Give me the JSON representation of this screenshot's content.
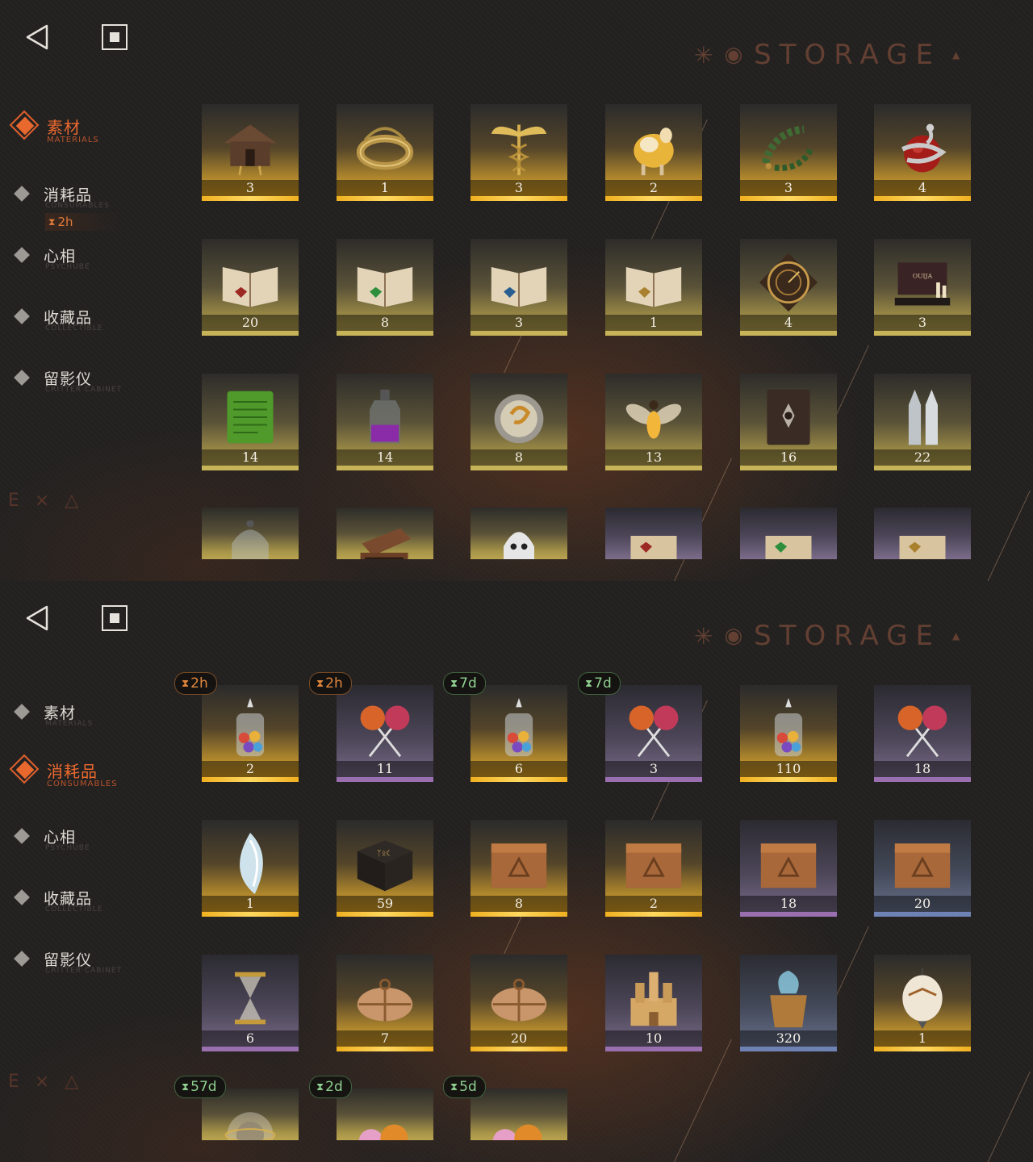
{
  "colors": {
    "accent": "#e8682e",
    "gold": "#e0a11e",
    "purple": "#9a6fb0",
    "blue": "#6f82b4",
    "khaki": "#c8b458",
    "timer_green": "#8fcf8f",
    "timer_orange": "#e0863c"
  },
  "header": {
    "title": "STORAGE",
    "back_icon": "back-triangle-icon",
    "stop_icon": "square-stop-icon"
  },
  "sidebar_deco": "E × △",
  "panels": [
    {
      "sidebar": [
        {
          "cn": "素材",
          "en": "MATERIALS",
          "active": true
        },
        {
          "cn": "消耗品",
          "en": "CONSUMABLES",
          "active": false,
          "timer": "2h"
        },
        {
          "cn": "心相",
          "en": "PSYCHUBE",
          "active": false
        },
        {
          "cn": "收藏品",
          "en": "COLLECTIBLE",
          "active": false
        },
        {
          "cn": "留影仪",
          "en": "CRITTER CABINET",
          "active": false
        }
      ],
      "rows": [
        [
          {
            "icon": "hut-icon",
            "qty": "3",
            "rarity": "gold"
          },
          {
            "icon": "ring-icon",
            "qty": "1",
            "rarity": "gold"
          },
          {
            "icon": "caduceus-icon",
            "qty": "3",
            "rarity": "gold"
          },
          {
            "icon": "golden-sheep-icon",
            "qty": "2",
            "rarity": "gold"
          },
          {
            "icon": "laurel-wreath-icon",
            "qty": "3",
            "rarity": "gold"
          },
          {
            "icon": "apple-serpent-icon",
            "qty": "4",
            "rarity": "gold"
          }
        ],
        [
          {
            "icon": "red-spellbook-icon",
            "qty": "20",
            "rarity": "khaki"
          },
          {
            "icon": "green-spellbook-icon",
            "qty": "8",
            "rarity": "khaki"
          },
          {
            "icon": "blue-spellbook-icon",
            "qty": "3",
            "rarity": "khaki"
          },
          {
            "icon": "gold-spellbook-icon",
            "qty": "1",
            "rarity": "khaki"
          },
          {
            "icon": "astrolabe-icon",
            "qty": "4",
            "rarity": "khaki"
          },
          {
            "icon": "ouija-board-icon",
            "qty": "3",
            "rarity": "khaki"
          }
        ],
        [
          {
            "icon": "green-tablet-icon",
            "qty": "14",
            "rarity": "khaki"
          },
          {
            "icon": "potion-bottle-icon",
            "qty": "14",
            "rarity": "khaki"
          },
          {
            "icon": "pocket-watch-icon",
            "qty": "8",
            "rarity": "khaki"
          },
          {
            "icon": "firefly-icon",
            "qty": "13",
            "rarity": "khaki"
          },
          {
            "icon": "dark-tome-icon",
            "qty": "16",
            "rarity": "khaki"
          },
          {
            "icon": "bullets-icon",
            "qty": "22",
            "rarity": "khaki"
          }
        ],
        [
          {
            "icon": "bell-jar-icon",
            "qty": "",
            "rarity": "khaki"
          },
          {
            "icon": "open-case-icon",
            "qty": "",
            "rarity": "khaki"
          },
          {
            "icon": "ghost-icon",
            "qty": "",
            "rarity": "khaki"
          },
          {
            "icon": "red-scroll-icon",
            "qty": "",
            "rarity": "purple"
          },
          {
            "icon": "green-scroll-icon",
            "qty": "",
            "rarity": "purple"
          },
          {
            "icon": "gold-scroll-icon",
            "qty": "",
            "rarity": "purple"
          }
        ]
      ]
    },
    {
      "sidebar": [
        {
          "cn": "素材",
          "en": "MATERIALS",
          "active": false
        },
        {
          "cn": "消耗品",
          "en": "CONSUMABLES",
          "active": true
        },
        {
          "cn": "心相",
          "en": "PSYCHUBE",
          "active": false
        },
        {
          "cn": "收藏品",
          "en": "COLLECTIBLE",
          "active": false
        },
        {
          "cn": "留影仪",
          "en": "CRITTER CABINET",
          "active": false
        }
      ],
      "rows": [
        [
          {
            "icon": "candy-jar-icon",
            "qty": "2",
            "rarity": "gold",
            "badge": "2h",
            "badge_color": "orange"
          },
          {
            "icon": "lollipops-icon",
            "qty": "11",
            "rarity": "purple",
            "badge": "2h",
            "badge_color": "orange"
          },
          {
            "icon": "candy-jar-icon",
            "qty": "6",
            "rarity": "gold",
            "badge": "7d",
            "badge_color": "green"
          },
          {
            "icon": "lollipops-icon",
            "qty": "3",
            "rarity": "purple",
            "badge": "7d",
            "badge_color": "green"
          },
          {
            "icon": "candy-jar-icon",
            "qty": "110",
            "rarity": "gold"
          },
          {
            "icon": "lollipops-icon",
            "qty": "18",
            "rarity": "purple"
          }
        ],
        [
          {
            "icon": "crystal-wisp-icon",
            "qty": "1",
            "rarity": "gold"
          },
          {
            "icon": "rune-box-icon",
            "qty": "59",
            "rarity": "gold"
          },
          {
            "icon": "wooden-crate-icon",
            "qty": "8",
            "rarity": "gold"
          },
          {
            "icon": "wooden-crate-icon",
            "qty": "2",
            "rarity": "gold"
          },
          {
            "icon": "wooden-crate-icon",
            "qty": "18",
            "rarity": "purple"
          },
          {
            "icon": "wooden-crate-icon",
            "qty": "20",
            "rarity": "blue"
          }
        ],
        [
          {
            "icon": "hourglass-item-icon",
            "qty": "6",
            "rarity": "purple"
          },
          {
            "icon": "parcel-icon",
            "qty": "7",
            "rarity": "gold"
          },
          {
            "icon": "parcel-icon",
            "qty": "20",
            "rarity": "gold"
          },
          {
            "icon": "sand-castle-icon",
            "qty": "10",
            "rarity": "purple"
          },
          {
            "icon": "magic-bucket-icon",
            "qty": "320",
            "rarity": "blue"
          },
          {
            "icon": "paper-lantern-icon",
            "qty": "1",
            "rarity": "gold"
          }
        ],
        [
          {
            "icon": "glass-orb-icon",
            "qty": "",
            "rarity": "khaki",
            "badge": "57d",
            "badge_color": "green"
          },
          {
            "icon": "wrapped-candies-icon",
            "qty": "",
            "rarity": "khaki",
            "badge": "2d",
            "badge_color": "green"
          },
          {
            "icon": "wrapped-candies-icon",
            "qty": "",
            "rarity": "khaki",
            "badge": "5d",
            "badge_color": "green"
          }
        ]
      ]
    }
  ]
}
